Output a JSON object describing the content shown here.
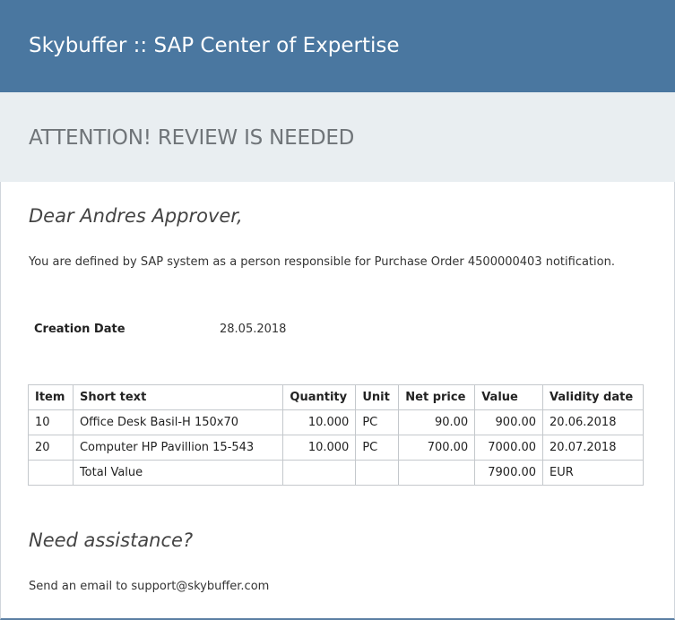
{
  "header": {
    "title": "Skybuffer :: SAP Center of Expertise"
  },
  "banner": {
    "text": "ATTENTION! REVIEW IS NEEDED"
  },
  "greeting": "Dear Andres Approver,",
  "intro": "You are defined by SAP system as a person responsible for Purchase Order 4500000403 notification.",
  "creation_date": {
    "label": "Creation Date",
    "value": "28.05.2018"
  },
  "table": {
    "headers": [
      "Item",
      "Short text",
      "Quantity",
      "Unit",
      "Net price",
      "Value",
      "Validity date"
    ],
    "rows": [
      [
        "10",
        "Office Desk Basil-H 150x70",
        "10.000",
        "PC",
        "90.00",
        "900.00",
        "20.06.2018"
      ],
      [
        "20",
        "Computer HP Pavillion 15-543",
        "10.000",
        "PC",
        "700.00",
        "7000.00",
        "20.07.2018"
      ],
      [
        "",
        "Total Value",
        "",
        "",
        "",
        "7900.00",
        "EUR"
      ]
    ]
  },
  "assistance": {
    "heading": "Need assistance?",
    "text": "Send an email to support@skybuffer.com"
  },
  "colors": {
    "header_bg": "#4a77a0",
    "banner_bg": "#e9eef1",
    "border_bottom": "#5b7fa3"
  }
}
